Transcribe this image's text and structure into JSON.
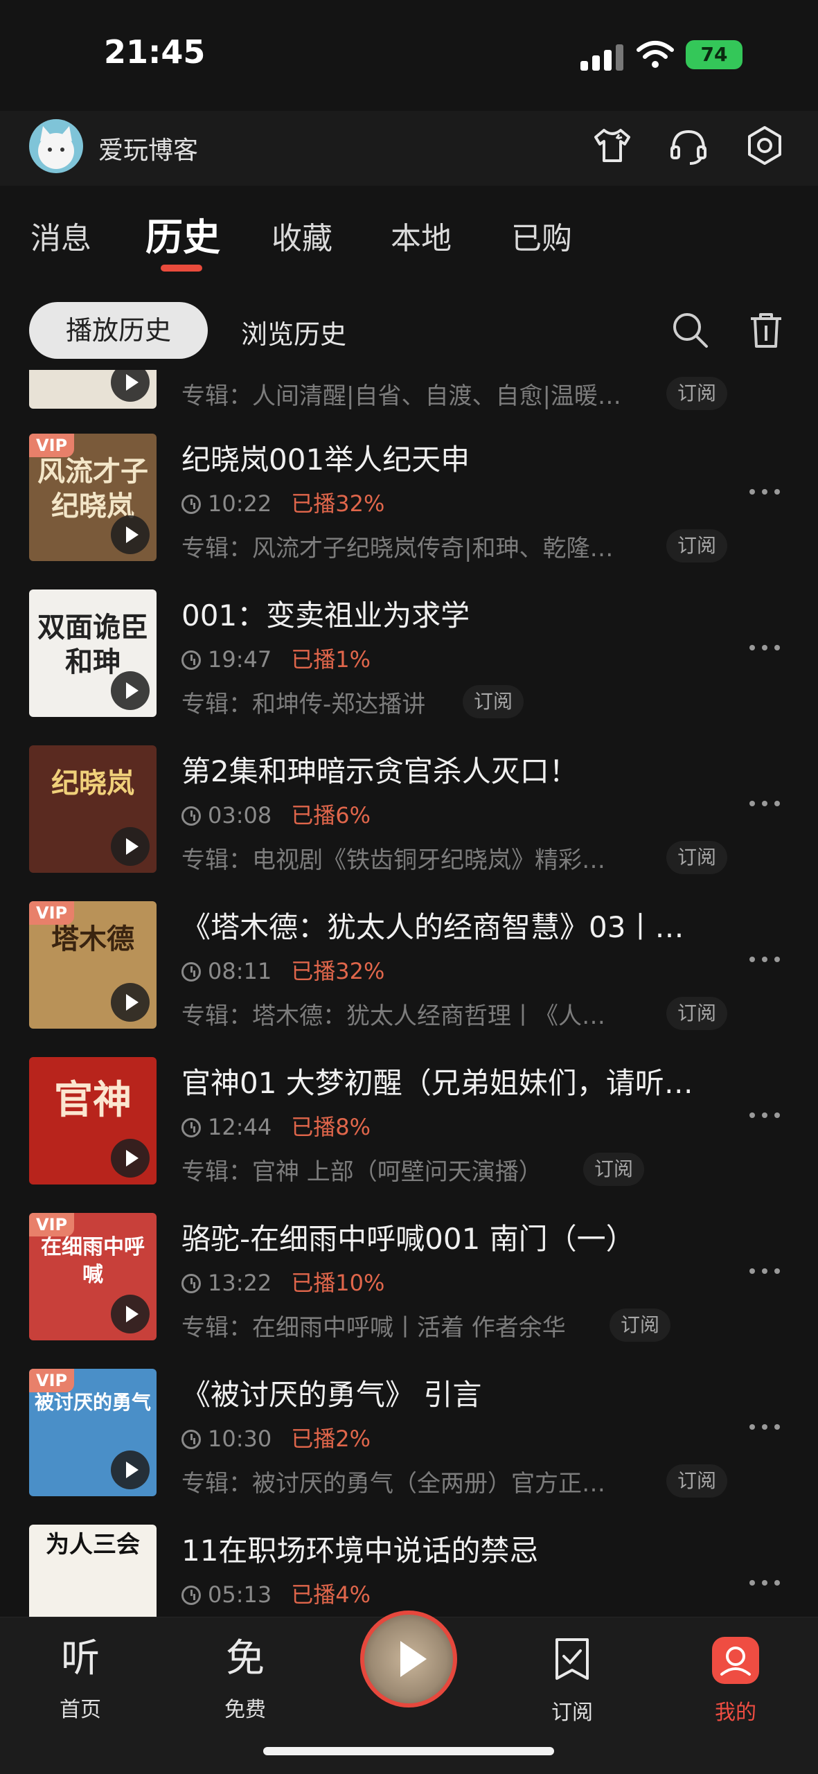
{
  "status": {
    "time": "21:45",
    "battery": "74"
  },
  "profile": {
    "name": "爱玩博客"
  },
  "tabs": [
    {
      "label": "消息"
    },
    {
      "label": "历史"
    },
    {
      "label": "收藏"
    },
    {
      "label": "本地"
    },
    {
      "label": "已购"
    }
  ],
  "subtabs": {
    "active": "播放历史",
    "other": "浏览历史"
  },
  "items": [
    {
      "title": "",
      "duration": "",
      "played": "",
      "album": "专辑：人间清醒|自省、自渡、自愈|温暖…",
      "subscribe": "订阅",
      "vip": "",
      "cover_text": "",
      "cover_color": "#e8e2d6"
    },
    {
      "title": "纪晓岚001举人纪天申",
      "duration": "10:22",
      "played": "已播32%",
      "album": "专辑：风流才子纪晓岚传奇|和珅、乾隆…",
      "subscribe": "订阅",
      "vip": "VIP",
      "cover_text": "风流才子纪晓岚",
      "cover_color": "#7a5a3a"
    },
    {
      "title": "001：变卖祖业为求学",
      "duration": "19:47",
      "played": "已播1%",
      "album": "专辑：和坤传-郑达播讲",
      "subscribe": "订阅",
      "vip": "",
      "cover_text": "双面诡臣和珅",
      "cover_color": "#f2f0ec"
    },
    {
      "title": "第2集和珅暗示贪官杀人灭口！",
      "duration": "03:08",
      "played": "已播6%",
      "album": "专辑：电视剧《铁齿铜牙纪晓岚》精彩…",
      "subscribe": "订阅",
      "vip": "",
      "cover_text": "纪晓岚",
      "cover_color": "#5a2a20"
    },
    {
      "title": "《塔木德：犹太人的经商智慧》03丨…",
      "duration": "08:11",
      "played": "已播32%",
      "album": "专辑：塔木德：犹太人经商哲理丨《人…",
      "subscribe": "订阅",
      "vip": "VIP",
      "cover_text": "塔木德",
      "cover_color": "#b99258"
    },
    {
      "title": "官神01 大梦初醒（兄弟姐妹们，请听…",
      "duration": "12:44",
      "played": "已播8%",
      "album": "专辑：官神 上部（呵壁问天演播）",
      "subscribe": "订阅",
      "vip": "",
      "cover_text": "官神",
      "cover_color": "#b8241c"
    },
    {
      "title": "骆驼-在细雨中呼喊001 南门（一）",
      "duration": "13:22",
      "played": "已播10%",
      "album": "专辑：在细雨中呼喊丨活着 作者余华",
      "subscribe": "订阅",
      "vip": "VIP",
      "cover_text": "在细雨中呼喊",
      "cover_color": "#c8403a"
    },
    {
      "title": "《被讨厌的勇气》 引言",
      "duration": "10:30",
      "played": "已播2%",
      "album": "专辑：被讨厌的勇气（全两册）官方正…",
      "subscribe": "订阅",
      "vip": "VIP",
      "cover_text": "被讨厌的勇气",
      "cover_color": "#4a8fc8"
    },
    {
      "title": "11在职场环境中说话的禁忌",
      "duration": "05:13",
      "played": "已播4%",
      "album": "",
      "subscribe": "",
      "vip": "",
      "cover_text": "为人三会",
      "cover_color": "#f4f1ea"
    }
  ],
  "bottom_nav": [
    {
      "glyph": "听",
      "label": "首页"
    },
    {
      "glyph": "免",
      "label": "免费"
    },
    {
      "glyph": "",
      "label": "订阅"
    },
    {
      "glyph": "",
      "label": "我的"
    }
  ],
  "colors": {
    "accent": "#e94b3c",
    "played": "#e0664b",
    "background": "#141414"
  }
}
